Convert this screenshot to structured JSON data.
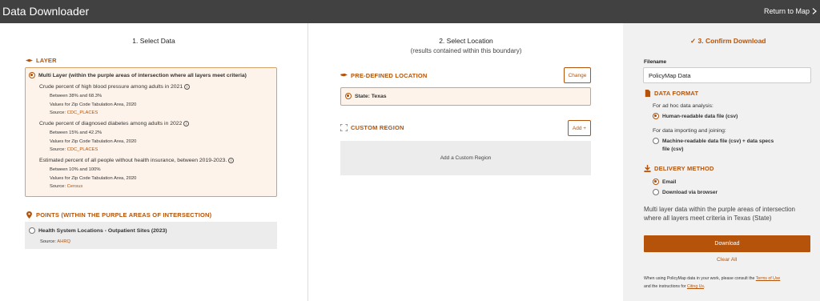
{
  "header": {
    "title": "Data Downloader",
    "return_label": "Return to Map"
  },
  "select_data": {
    "title": "1. Select Data",
    "layer_heading": "LAYER",
    "multi_layer_label": "Multi Layer (within the purple areas of intersection where all layers meet criteria)",
    "layers": [
      {
        "name": "Crude percent of high blood pressure among adults in 2021",
        "range": "Between 38% and 68.3%",
        "values": "Values for Zip Code Tabulation Area, 2020",
        "source_prefix": "Source:",
        "source": "CDC_PLACES"
      },
      {
        "name": "Crude percent of diagnosed diabetes among adults in 2022",
        "range": "Between 15% and 42.2%",
        "values": "Values for Zip Code Tabulation Area, 2020",
        "source_prefix": "Source:",
        "source": "CDC_PLACES"
      },
      {
        "name": "Estimated percent of all people without health insurance, between 2019-2023.",
        "range": "Between 10% and 100%",
        "values": "Values for Zip Code Tabulation Area, 2020",
        "source_prefix": "Source:",
        "source": "Census"
      }
    ],
    "points_heading": "POINTS (WITHIN THE PURPLE AREAS OF INTERSECTION)",
    "points_item": {
      "label": "Health System Locations - Outpatient Sites (2023)",
      "source_prefix": "Source:",
      "source": "AHRQ"
    }
  },
  "select_location": {
    "title": "2. Select Location",
    "subtitle": "(results contained within this boundary)",
    "predefined_heading": "PRE-DEFINED LOCATION",
    "change_label": "Change",
    "state_label": "State: Texas",
    "custom_heading": "CUSTOM REGION",
    "add_label": "Add +",
    "add_custom_label": "Add a Custom Region"
  },
  "confirm": {
    "title": "3. Confirm Download",
    "filename_label": "Filename",
    "filename_value": "PolicyMap Data",
    "data_format_heading": "DATA FORMAT",
    "adhoc_label": "For ad hoc data analysis:",
    "human_readable": "Human-readable data file (csv)",
    "importing_label": "For data importing and joining:",
    "machine_readable_1": "Machine-readable data file (csv) + data specs",
    "machine_readable_2": "file (csv)",
    "delivery_heading": "DELIVERY METHOD",
    "email_label": "Email",
    "browser_label": "Download via browser",
    "summary_1": "Multi layer data within the purple areas of intersection",
    "summary_2": "where all layers meet criteria in Texas (State)",
    "download_label": "Download",
    "clear_label": "Clear All",
    "footer_1a": "When using PolicyMap data in your work, please consult the",
    "terms_link": "Terms of Use",
    "footer_2a": "and the instructions for",
    "citing_link": "Citing Us",
    "footer_2b": "."
  },
  "colors": {
    "accent": "#b45309",
    "topbar": "#414141",
    "panel": "#f1f1f1"
  }
}
